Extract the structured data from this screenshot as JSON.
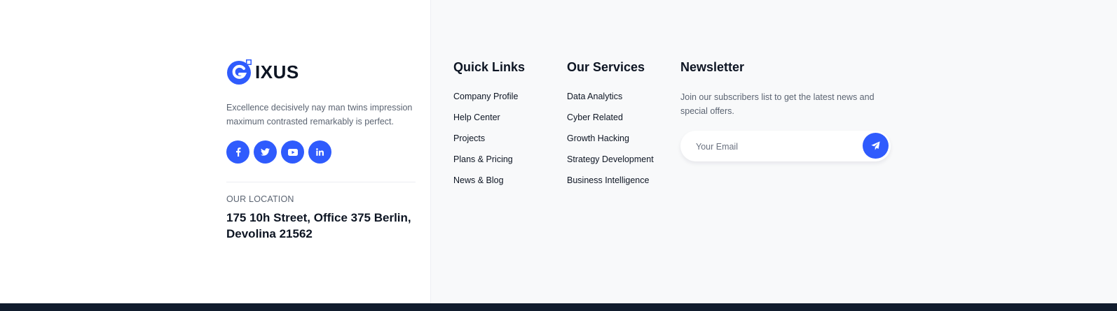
{
  "brand": {
    "logo_text": "IXUS",
    "description": "Excellence decisively nay man twins impression maximum contrasted remarkably is perfect.",
    "accent_color": "#2f5bfd"
  },
  "socials": [
    {
      "icon": "facebook-icon"
    },
    {
      "icon": "twitter-icon"
    },
    {
      "icon": "youtube-icon"
    },
    {
      "icon": "linkedin-icon"
    }
  ],
  "location": {
    "label": "OUR LOCATION",
    "address": "175 10h Street, Office 375 Berlin, Devolina 21562"
  },
  "quick_links": {
    "title": "Quick Links",
    "items": [
      "Company Profile",
      "Help Center",
      "Projects",
      "Plans & Pricing",
      "News & Blog"
    ]
  },
  "services": {
    "title": "Our Services",
    "items": [
      "Data Analytics",
      "Cyber Related",
      "Growth Hacking",
      "Strategy Development",
      "Business Intelligence"
    ]
  },
  "newsletter": {
    "title": "Newsletter",
    "text": "Join our subscribers list to get the latest news and special offers.",
    "placeholder": "Your Email",
    "submit_icon": "paper-plane-icon"
  },
  "colors": {
    "panel_bg": "#f8f9fa",
    "bottom_bar": "#111c2d",
    "heading": "#0d1523",
    "muted": "#5b6472"
  }
}
